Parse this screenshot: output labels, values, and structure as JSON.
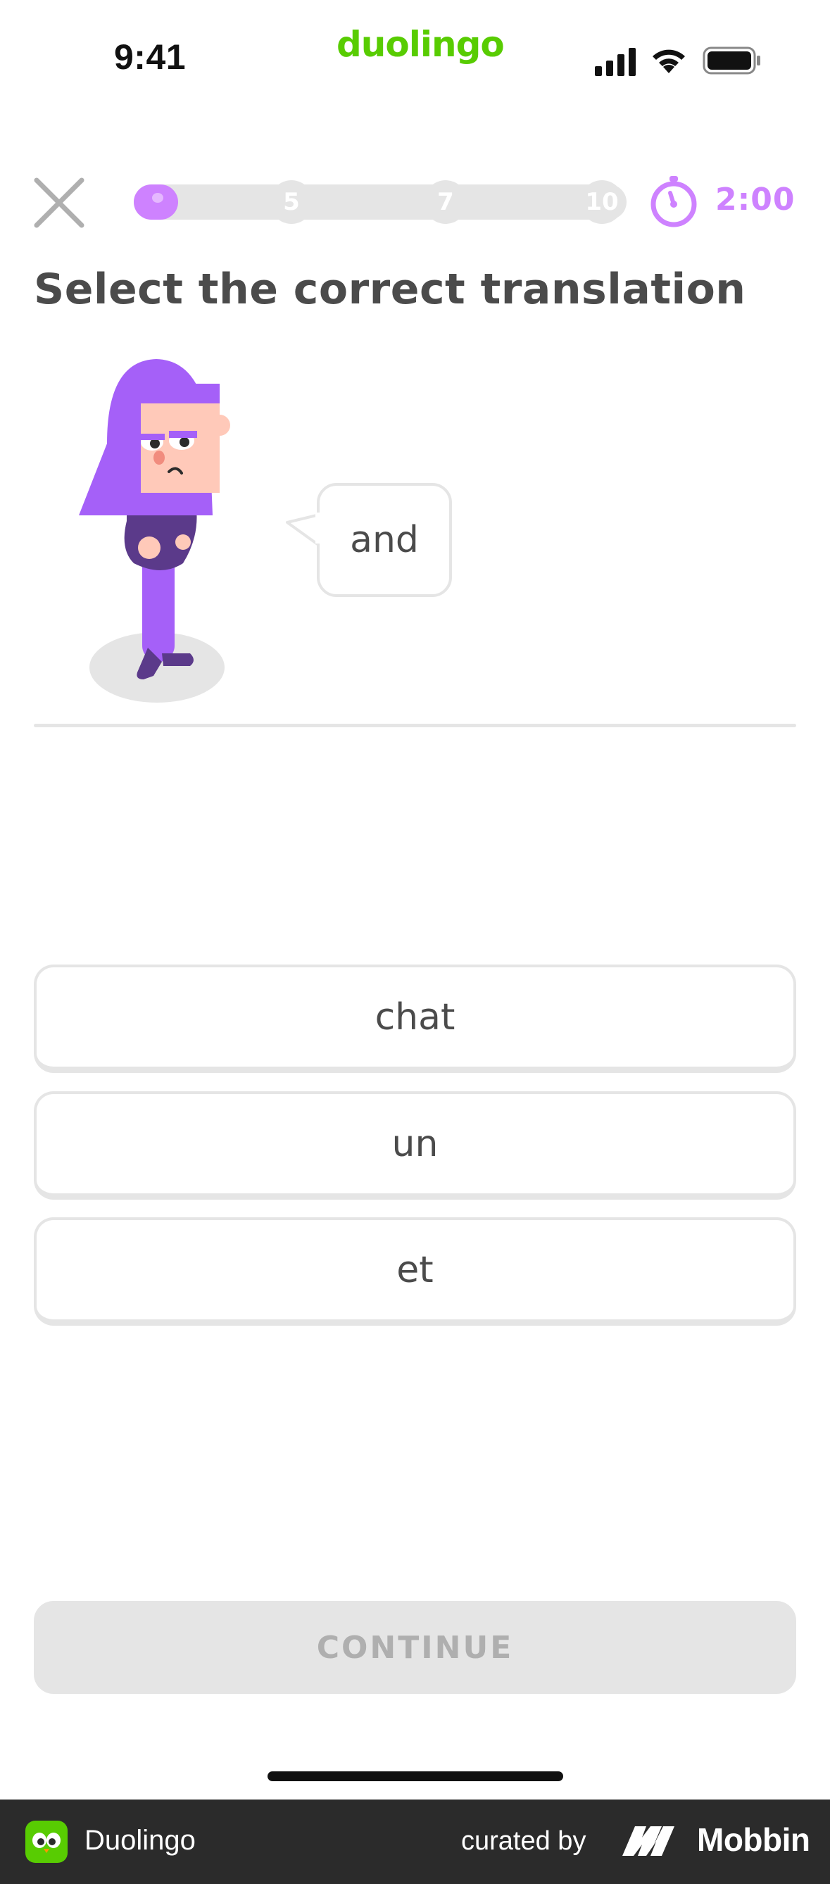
{
  "status_bar": {
    "time": "9:41",
    "brand": "duolingo",
    "icons": [
      "signal-icon",
      "wifi-icon",
      "battery-icon"
    ]
  },
  "header": {
    "close_icon": "close-icon",
    "progress": {
      "fraction": 0.09,
      "milestones": [
        "5",
        "7",
        "10"
      ]
    },
    "timer": {
      "icon": "timer-icon",
      "value": "2:00"
    }
  },
  "prompt": {
    "title": "Select the correct translation",
    "word": "and"
  },
  "options": [
    {
      "label": "chat"
    },
    {
      "label": "un"
    },
    {
      "label": "et"
    }
  ],
  "actions": {
    "continue_label": "CONTINUE"
  },
  "footer": {
    "app_name": "Duolingo",
    "curated_by": "curated by",
    "brand": "Mobbin"
  },
  "colors": {
    "accent": "#ce82ff",
    "brand_green": "#58cc02",
    "border": "#e5e5e5",
    "text": "#4b4b4b",
    "disabled_text": "#afafaf"
  }
}
